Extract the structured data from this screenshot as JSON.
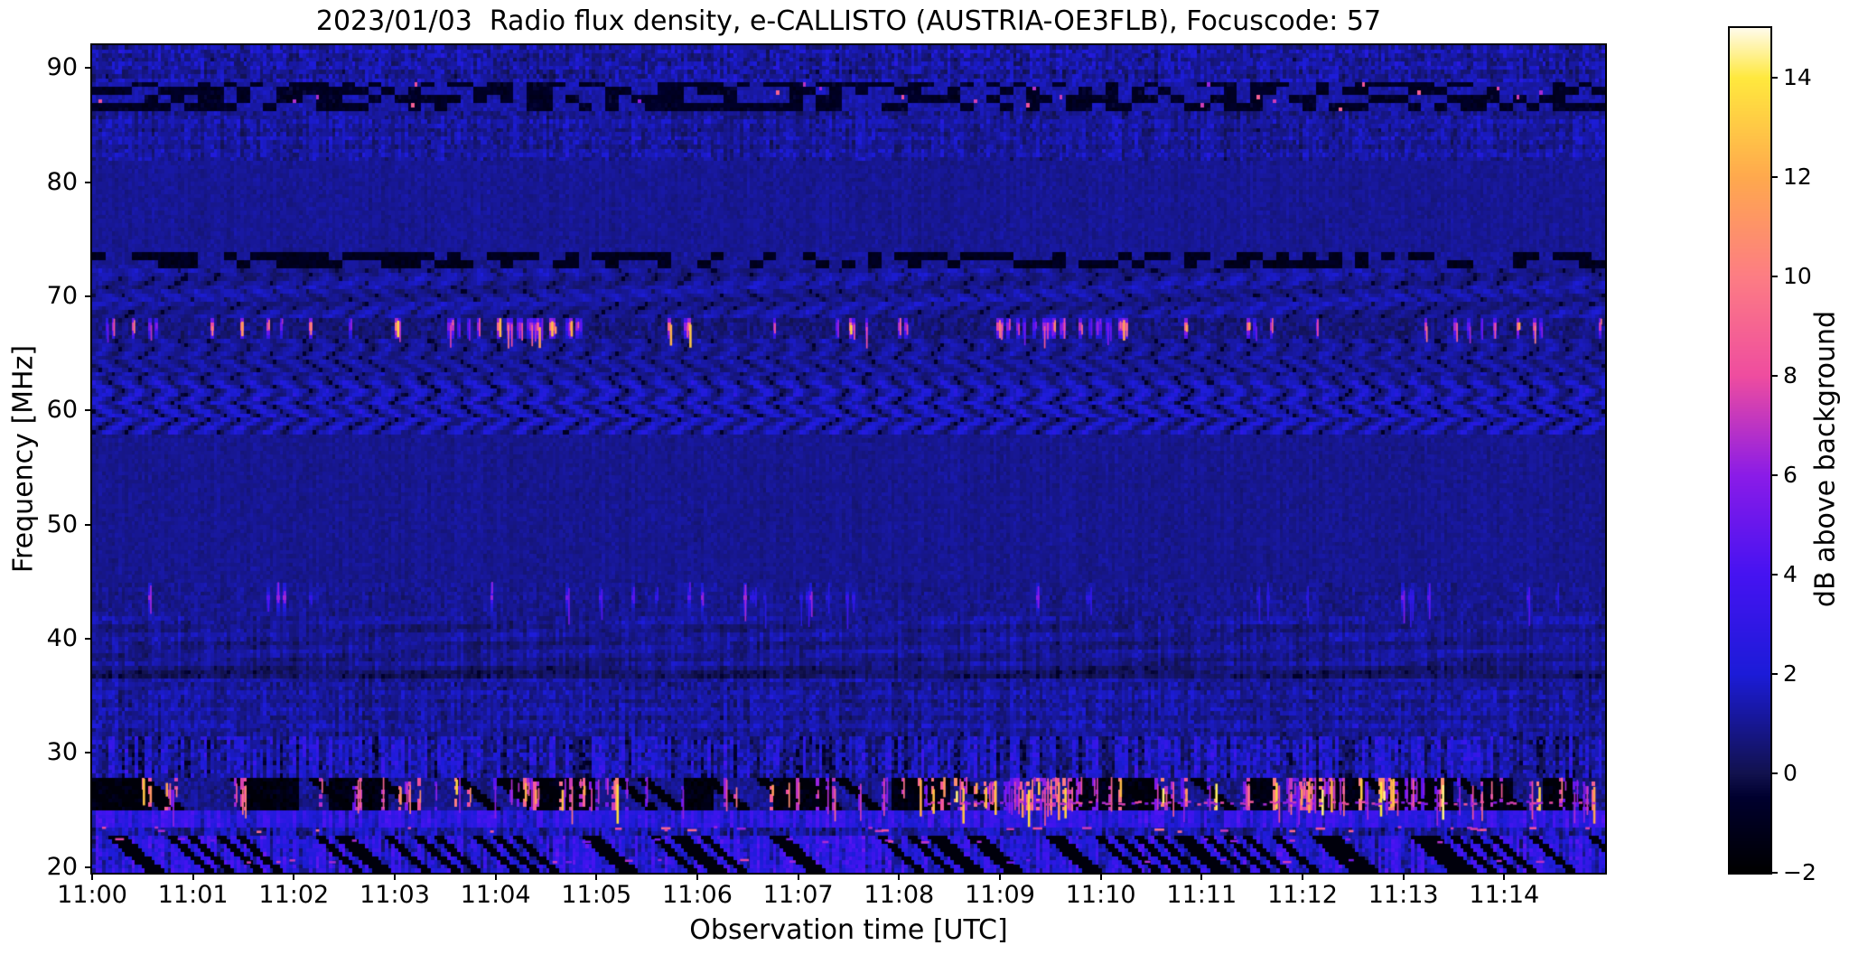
{
  "chart_data": {
    "type": "heatmap",
    "subtype": "radio-spectrogram",
    "title": "2023/01/03  Radio flux density, e-CALLISTO (AUSTRIA-OE3FLB), Focuscode: 57",
    "xlabel": "Observation time [UTC]",
    "ylabel": "Frequency [MHz]",
    "x_tick_labels": [
      "11:00",
      "11:01",
      "11:02",
      "11:03",
      "11:04",
      "11:05",
      "11:06",
      "11:07",
      "11:08",
      "11:09",
      "11:10",
      "11:11",
      "11:12",
      "11:13",
      "11:14"
    ],
    "x_range_minutes": [
      0,
      15
    ],
    "y_tick_values": [
      90,
      80,
      70,
      60,
      50,
      40,
      30,
      20
    ],
    "y_tick_labels": [
      "90",
      "80",
      "70",
      "60",
      "50",
      "40",
      "30",
      "20"
    ],
    "y_range_mhz": [
      19.5,
      92.0
    ],
    "grid_on": false,
    "colorbar": {
      "label": "dB above background",
      "min": -2,
      "max": 15,
      "tick_values": [
        14,
        12,
        10,
        8,
        6,
        4,
        2,
        0,
        -2
      ],
      "tick_labels": [
        "14",
        "12",
        "10",
        "8",
        "6",
        "4",
        "2",
        "0",
        "−2"
      ],
      "colormap_stops_db": [
        [
          -2.0,
          "#000000"
        ],
        [
          -0.5,
          "#00002e"
        ],
        [
          0.0,
          "#12124e"
        ],
        [
          2.0,
          "#1c1cd8"
        ],
        [
          4.0,
          "#4613f2"
        ],
        [
          6.0,
          "#8b1ce8"
        ],
        [
          8.0,
          "#ef4da0"
        ],
        [
          10.0,
          "#fd7d84"
        ],
        [
          12.0,
          "#ffa94e"
        ],
        [
          14.0,
          "#ffe93e"
        ],
        [
          15.0,
          "#fffbea"
        ]
      ]
    },
    "background_level_db": 1.0,
    "seed": 20230103,
    "grid": {
      "cols": 460,
      "rows": 200
    },
    "bands": [
      {
        "name": "top-speckle",
        "f": [
          88.6,
          92.0
        ],
        "base": 1.05,
        "noise": 1.05,
        "style": "speckle"
      },
      {
        "name": "dark-rfi-rows-87",
        "f": [
          86.2,
          88.6
        ],
        "base": 0.45,
        "noise": 1.25,
        "style": "dashrow",
        "pink_prob": 0.006
      },
      {
        "name": "upper-speckle",
        "f": [
          82.0,
          86.2
        ],
        "base": 1.0,
        "noise": 0.85,
        "style": "speckle"
      },
      {
        "name": "quiet-74-82",
        "f": [
          74.0,
          82.0
        ],
        "base": 0.95,
        "noise": 0.5,
        "style": "smooth"
      },
      {
        "name": "dark-dash-row-73",
        "f": [
          72.6,
          74.0
        ],
        "base": 0.2,
        "noise": 1.1,
        "style": "dashrow",
        "pink_prob": 0.0
      },
      {
        "name": "herringbone-68-73",
        "f": [
          68.1,
          72.6
        ],
        "base": 1.0,
        "noise": 0.55,
        "style": "herringbone",
        "amp": 0.6,
        "undulate": 0.35
      },
      {
        "name": "rfi-burst-line-67",
        "f": [
          66.3,
          68.1
        ],
        "base": 0.6,
        "noise": 0.9,
        "style": "burstrow",
        "burst_prob": 0.11,
        "burst_db": [
          5,
          13.5
        ],
        "hotspots": [
          0.27,
          0.64
        ]
      },
      {
        "name": "herringbone-62-66",
        "f": [
          62.6,
          66.3
        ],
        "base": 0.95,
        "noise": 0.6,
        "style": "herringbone",
        "amp": 0.8,
        "undulate": 0.0
      },
      {
        "name": "chevron-58-62",
        "f": [
          58.0,
          62.6
        ],
        "base": 1.2,
        "noise": 0.85,
        "style": "herringbone",
        "amp": 1.35,
        "undulate": 0.0
      },
      {
        "name": "quiet-45-58",
        "f": [
          45.0,
          58.0
        ],
        "base": 0.9,
        "noise": 0.5,
        "style": "smooth"
      },
      {
        "name": "faint-ticks-42-45",
        "f": [
          42.0,
          45.0
        ],
        "base": 0.85,
        "noise": 0.7,
        "style": "burstrow",
        "burst_prob": 0.05,
        "burst_db": [
          2.5,
          7
        ],
        "hotspots": [
          0.45
        ]
      },
      {
        "name": "faint-wavy-36-42",
        "f": [
          36.0,
          42.0
        ],
        "base": 0.8,
        "noise": 0.6,
        "style": "speckle",
        "dark_row": 37.2,
        "undulate": 0.25
      },
      {
        "name": "speckle-31-36",
        "f": [
          31.4,
          36.0
        ],
        "base": 1.0,
        "noise": 0.85,
        "style": "speckle"
      },
      {
        "name": "striated-28-31",
        "f": [
          27.9,
          31.4
        ],
        "base": 1.2,
        "noise": 1.7,
        "style": "streaky"
      },
      {
        "name": "rfi-orange-25-28",
        "f": [
          24.9,
          27.9
        ],
        "base": -0.5,
        "noise": 1.3,
        "style": "burstdark",
        "burst_prob": 0.17,
        "burst_db": [
          6,
          14.5
        ],
        "hotspots": [
          0.3,
          0.62,
          0.8
        ],
        "pink_line_f": 25.7
      },
      {
        "name": "bright-blue-row-24",
        "f": [
          23.6,
          24.9
        ],
        "base": 2.6,
        "noise": 0.9,
        "style": "streaky"
      },
      {
        "name": "pink-dash-row-23",
        "f": [
          22.9,
          23.6
        ],
        "base": 1.2,
        "noise": 1.1,
        "style": "dashline",
        "dash_prob": 0.06,
        "dash_db": [
          6,
          9.5
        ]
      },
      {
        "name": "bottom-streaks",
        "f": [
          19.5,
          22.9
        ],
        "base": 2.3,
        "noise": 1.5,
        "style": "streakygaps",
        "dash_rows": [
          22.4,
          20.6
        ],
        "dash_prob": 0.03,
        "dash_db": [
          5,
          8
        ]
      }
    ]
  }
}
